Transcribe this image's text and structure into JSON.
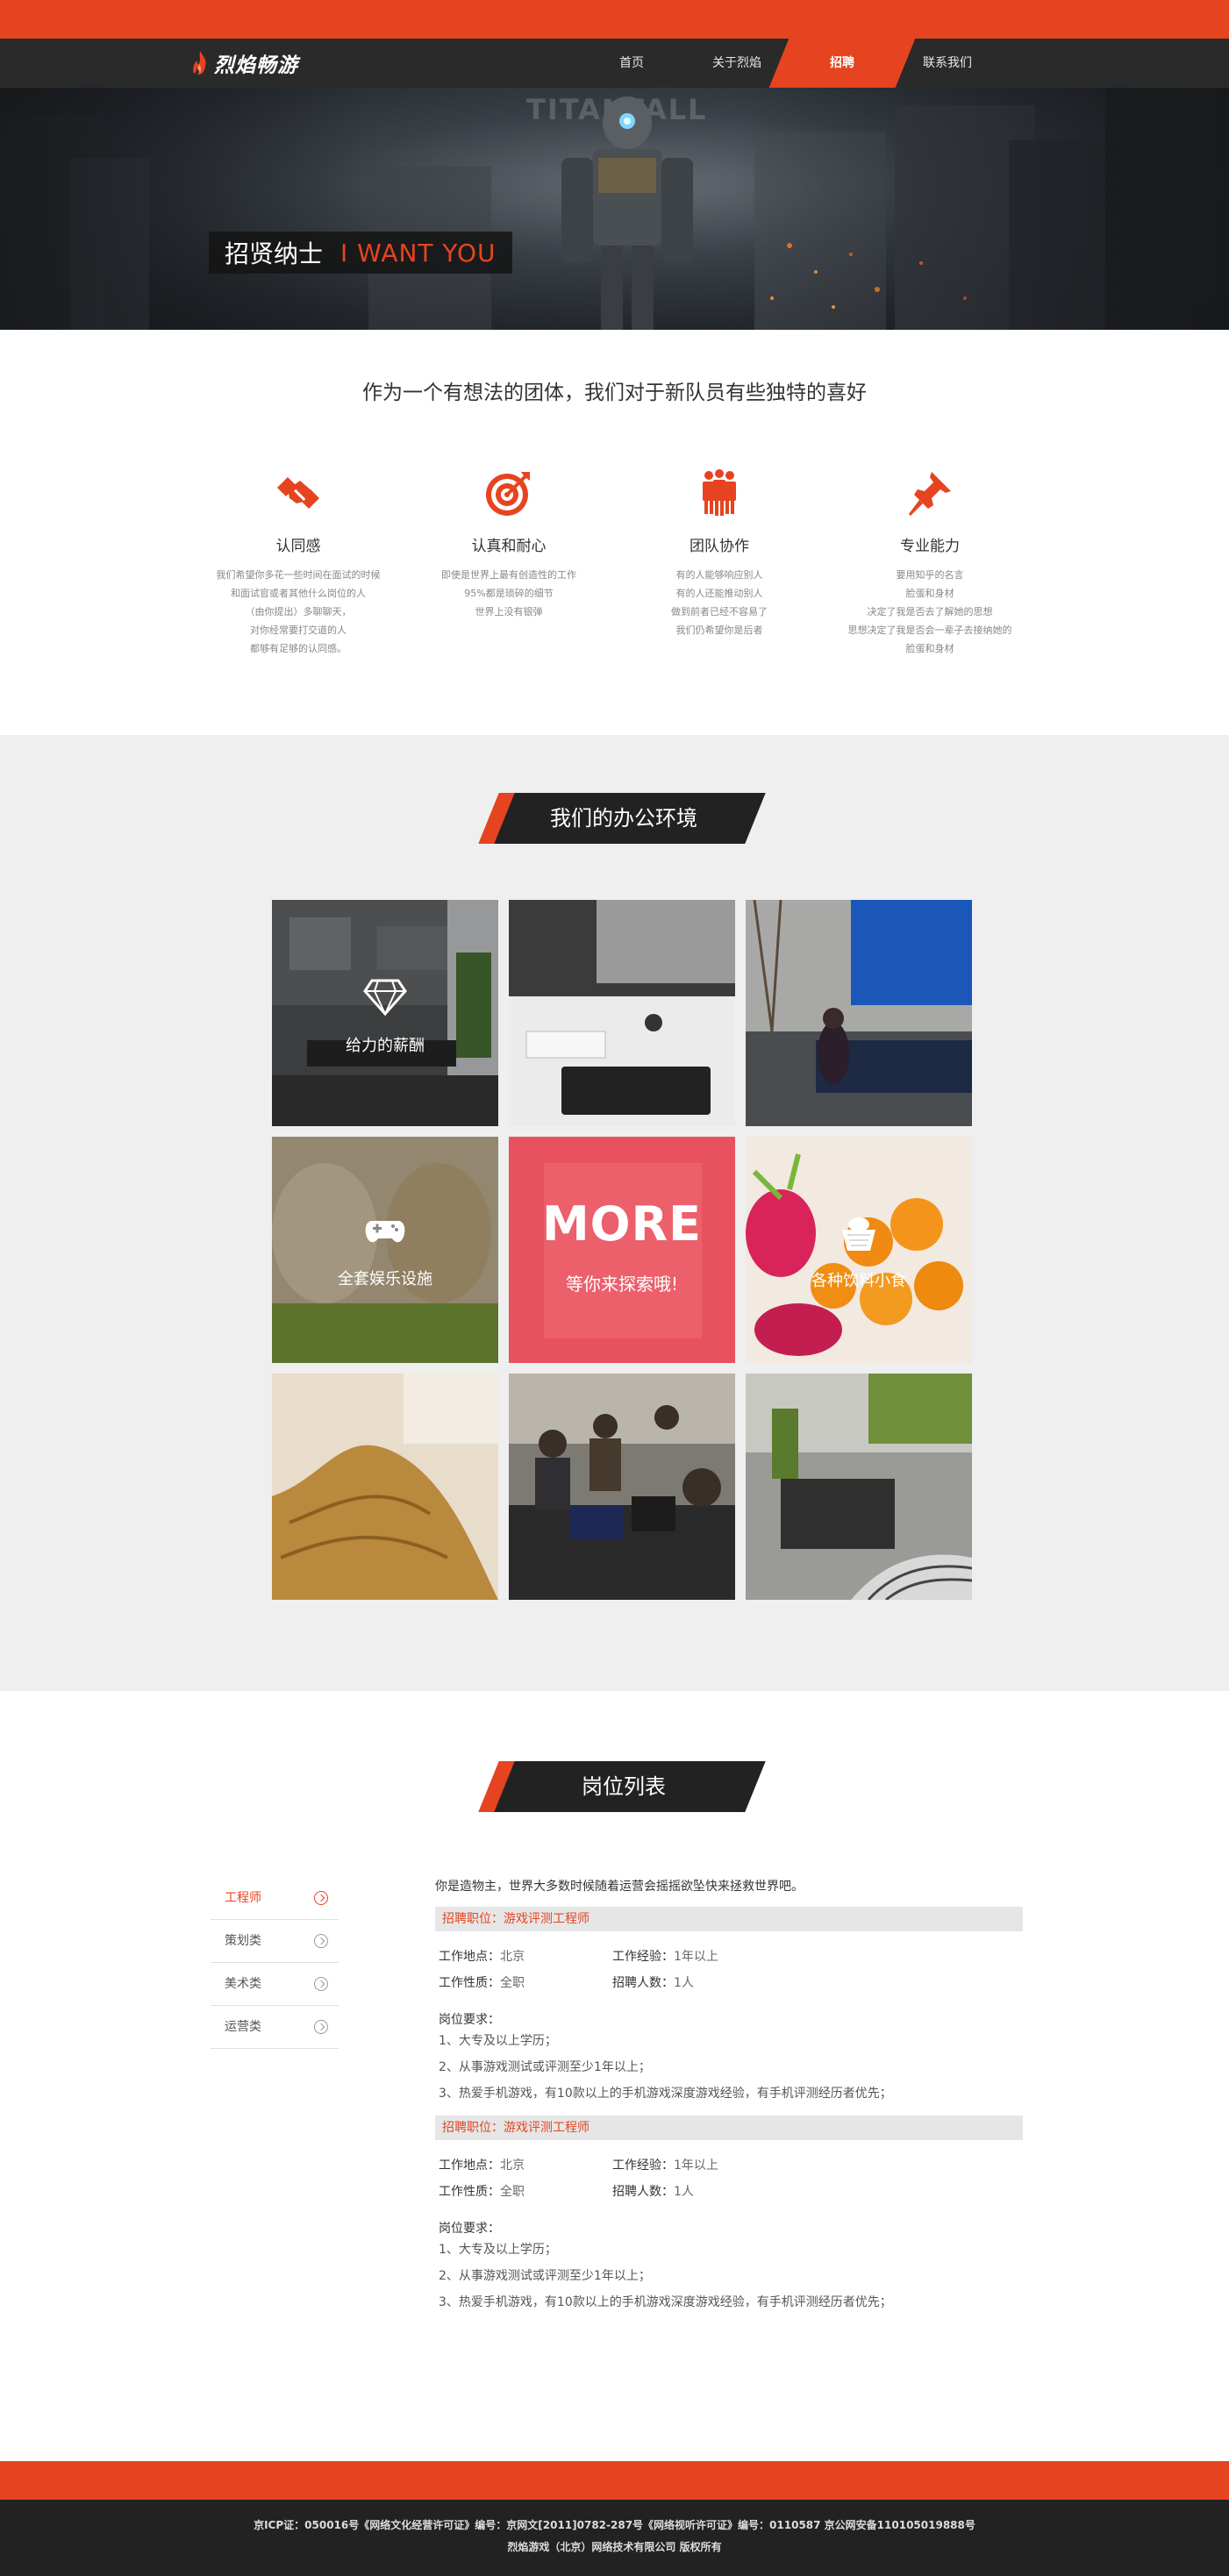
{
  "brand": {
    "logo_text": "烈焰畅游"
  },
  "nav": {
    "items": [
      {
        "label": "首页"
      },
      {
        "label": "关于烈焰"
      },
      {
        "label": "招聘"
      },
      {
        "label": "联系我们"
      }
    ],
    "active_index": 2
  },
  "hero": {
    "ghost_text": "TITANFALL",
    "title_cn": "招贤纳士",
    "title_en": "I WANT YOU"
  },
  "intro": {
    "title": "作为一个有想法的团体，我们对于新队员有些独特的喜好",
    "features": [
      {
        "icon": "handshake-icon",
        "title": "认同感",
        "desc": [
          "我们希望你多花一些时间在面试的时候",
          "和面试官或者其他什么岗位的人",
          "（由你提出）多聊聊天，",
          "对你经常要打交道的人",
          "都够有足够的认同感。"
        ]
      },
      {
        "icon": "target-icon",
        "title": "认真和耐心",
        "desc": [
          "即使是世界上最有创造性的工作",
          "95%都是琐碎的细节",
          "世界上没有银弹"
        ]
      },
      {
        "icon": "team-icon",
        "title": "团队协作",
        "desc": [
          "有的人能够响应别人",
          "有的人还能推动别人",
          "做到前者已经不容易了",
          "我们仍希望你是后者"
        ]
      },
      {
        "icon": "pushpin-icon",
        "title": "专业能力",
        "desc": [
          "要用知乎的名言",
          "脸蛋和身材",
          "决定了我是否去了解她的思想",
          "思想决定了我是否会一辈子去接纳她的",
          "脸蛋和身材"
        ]
      }
    ]
  },
  "office": {
    "title": "我们的办公环境",
    "tiles": [
      {
        "label": "给力的薪酬",
        "icon": "diamond-icon"
      },
      {
        "label": ""
      },
      {
        "label": ""
      },
      {
        "label": "全套娱乐设施",
        "icon": "gamepad-icon"
      },
      {
        "label": "等你来探索哦!",
        "more": "MORE"
      },
      {
        "label": "各种饮料小食",
        "icon": "basket-icon"
      },
      {
        "label": ""
      },
      {
        "label": ""
      },
      {
        "label": ""
      }
    ]
  },
  "jobs": {
    "title": "岗位列表",
    "categories": [
      {
        "label": "工程师"
      },
      {
        "label": "策划类"
      },
      {
        "label": "美术类"
      },
      {
        "label": "运营类"
      }
    ],
    "intro": "你是造物主，世界大多数时候随着运营会摇摇欲坠快来拯救世界吧。",
    "postings": [
      {
        "heading": "招聘职位：游戏评测工程师",
        "location_label": "工作地点：",
        "location": "北京",
        "experience_label": "工作经验：",
        "experience": "1年以上",
        "type_label": "工作性质：",
        "type": "全职",
        "count_label": "招聘人数：",
        "count": "1人",
        "req_title": "岗位要求：",
        "requirements": [
          "1、大专及以上学历；",
          "2、从事游戏测试或评测至少1年以上；",
          "3、热爱手机游戏，有10款以上的手机游戏深度游戏经验，有手机评测经历者优先；"
        ]
      },
      {
        "heading": "招聘职位：游戏评测工程师",
        "location_label": "工作地点：",
        "location": "北京",
        "experience_label": "工作经验：",
        "experience": "1年以上",
        "type_label": "工作性质：",
        "type": "全职",
        "count_label": "招聘人数：",
        "count": "1人",
        "req_title": "岗位要求：",
        "requirements": [
          "1、大专及以上学历；",
          "2、从事游戏测试或评测至少1年以上；",
          "3、热爱手机游戏，有10款以上的手机游戏深度游戏经验，有手机评测经历者优先；"
        ]
      }
    ]
  },
  "footer": {
    "line1": "京ICP证：050016号《网络文化经营许可证》编号：京网文[2011]0782-287号《网络视听许可证》编号：0110587 京公网安备110105019888号",
    "line2": "烈焰游戏（北京）网络技术有限公司 版权所有"
  },
  "colors": {
    "accent": "#e64420",
    "dark": "#222222",
    "panel": "#efefef"
  }
}
